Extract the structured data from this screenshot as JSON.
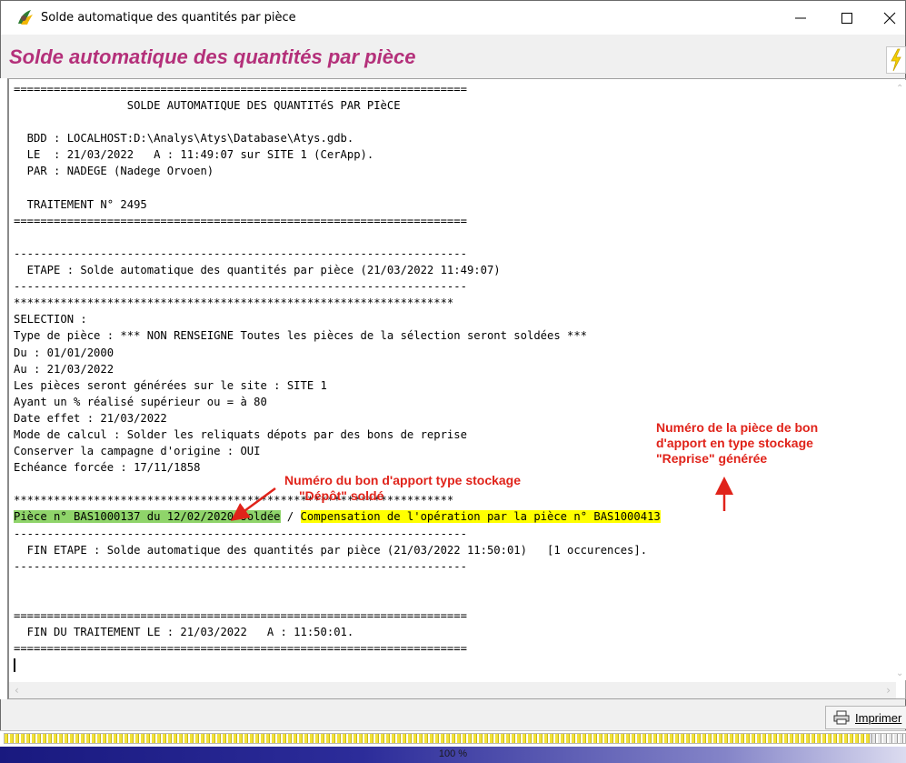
{
  "window": {
    "title": "Solde automatique des quantités par pièce",
    "app_icon": "atys-app-icon"
  },
  "header": {
    "heading": "Solde automatique des quantités par pièce",
    "bolt_icon": "lightning-icon"
  },
  "log": {
    "lines": [
      "====================================================================",
      "                 SOLDE AUTOMATIQUE DES QUANTITéS PAR PIèCE",
      "",
      "  BDD : LOCALHOST:D:\\Analys\\Atys\\Database\\Atys.gdb.",
      "  LE  : 21/03/2022   A : 11:49:07 sur SITE 1 (CerApp).",
      "  PAR : NADEGE (Nadege Orvoen)",
      "",
      "  TRAITEMENT N° 2495",
      "====================================================================",
      "",
      "--------------------------------------------------------------------",
      "  ETAPE : Solde automatique des quantités par pièce (21/03/2022 11:49:07)",
      "--------------------------------------------------------------------",
      "******************************************************************",
      "SELECTION :",
      "Type de pièce : *** NON RENSEIGNE Toutes les pièces de la sélection seront soldées ***",
      "Du : 01/01/2000",
      "Au : 21/03/2022",
      "Les pièces seront générées sur le site : SITE 1",
      "Ayant un % réalisé supérieur ou = à 80",
      "Date effet : 21/03/2022",
      "Mode de calcul : Solder les reliquats dépots par des bons de reprise",
      "Conserver la campagne d'origine : OUI",
      "Echéance forcée : 17/11/1858",
      "",
      "******************************************************************"
    ],
    "highlight_green": "Pièce n° BAS1000137 du 12/02/2020 soldée",
    "separator": " / ",
    "highlight_yellow": "Compensation de l'opération par la pièce n° BAS1000413",
    "lines_after": [
      "--------------------------------------------------------------------",
      "  FIN ETAPE : Solde automatique des quantités par pièce (21/03/2022 11:50:01)   [1 occurences].",
      "--------------------------------------------------------------------",
      "",
      "",
      "====================================================================",
      "  FIN DU TRAITEMENT LE : 21/03/2022   A : 11:50:01.",
      "===================================================================="
    ]
  },
  "annotations": {
    "reprise": [
      "Numéro de la pièce de bon",
      "d'apport en type stockage",
      "\"Reprise\" générée"
    ],
    "depot": [
      "Numéro du bon d'apport type stockage",
      "\"Dépôt\" soldé"
    ]
  },
  "toolbar": {
    "print_label": "Imprimer",
    "print_icon": "printer-icon"
  },
  "progress": {
    "value": 1.0,
    "label": "100 %"
  },
  "colors": {
    "heading": "#b4307a",
    "annotation": "#e0231a",
    "highlight_green": "#8fd46a",
    "highlight_yellow": "#ffff00",
    "progress": "#1b1b86"
  }
}
